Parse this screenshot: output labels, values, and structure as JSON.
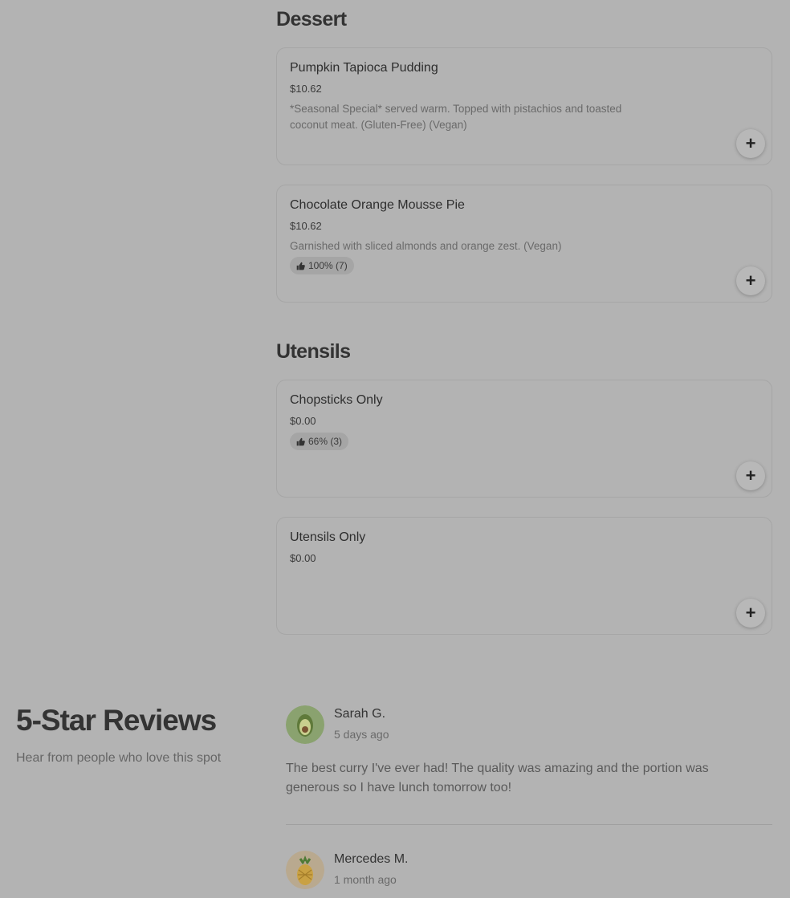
{
  "sections": {
    "dessert": "Dessert",
    "utensils": "Utensils"
  },
  "items": [
    {
      "name": "Pumpkin Tapioca Pudding",
      "price": "$10.62",
      "description": "*Seasonal Special* served warm. Topped with pistachios and toasted coconut meat. (Gluten-Free) (Vegan)",
      "rating": ""
    },
    {
      "name": "Chocolate Orange Mousse Pie",
      "price": "$10.62",
      "description": "Garnished with sliced almonds and orange zest. (Vegan)",
      "rating": "100% (7)"
    },
    {
      "name": "Chopsticks Only",
      "price": "$0.00",
      "description": "",
      "rating": "66% (3)"
    },
    {
      "name": "Utensils Only",
      "price": "$0.00",
      "description": "",
      "rating": ""
    }
  ],
  "add_label": "+",
  "reviews": {
    "title": "5-Star Reviews",
    "subtitle": "Hear from people who love this spot",
    "list": [
      {
        "name": "Sarah G.",
        "time": "5 days ago",
        "text": "The best curry I've ever had! The quality was amazing and the portion was generous so I have lunch tomorrow too!",
        "avatar_icon": "avocado-icon"
      },
      {
        "name": "Mercedes M.",
        "time": "1 month ago",
        "avatar_icon": "pineapple-icon"
      }
    ]
  }
}
